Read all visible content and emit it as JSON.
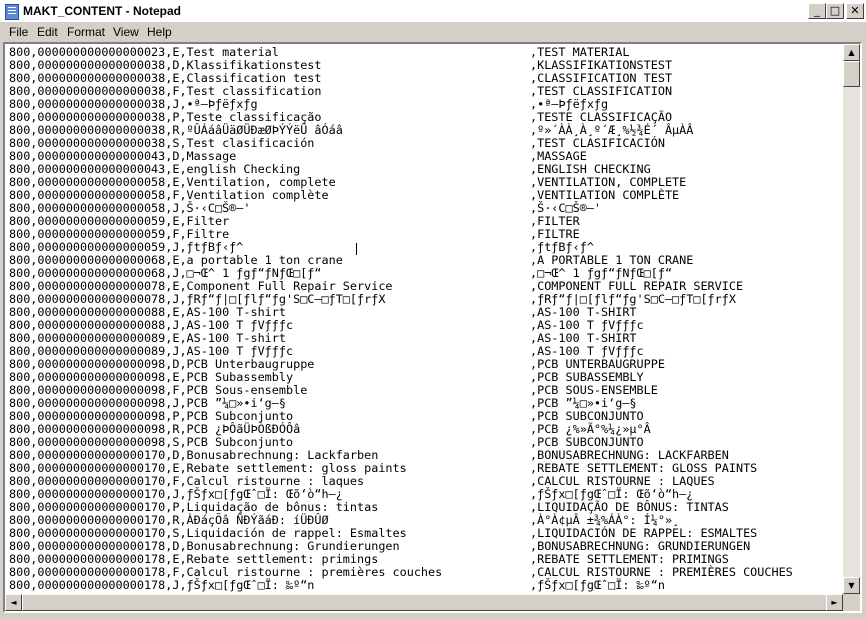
{
  "window": {
    "title": "MAKT_CONTENT - Notepad"
  },
  "menu": [
    "File",
    "Edit",
    "Format",
    "View",
    "Help"
  ],
  "lines": [
    [
      "800,000000000000000023,E,Test material",
      ",TEST MATERIAL"
    ],
    [
      "800,000000000000000038,D,Klassifikationstest",
      ",KLASSIFIKATIONSTEST"
    ],
    [
      "800,000000000000000038,E,Classification test",
      ",CLASSIFICATION TEST"
    ],
    [
      "800,000000000000000038,F,Test classification",
      ",TEST CLASSIFICATION"
    ],
    [
      "800,000000000000000038,J,•ª–Þƒëƒxƒg",
      ",•ª–Þƒëƒxƒg"
    ],
    [
      "800,000000000000000038,P,Teste classificação",
      ",TESTE CLASSIFICAÇÃO"
    ],
    [
      "800,000000000000000038,R,ºÛÁáâÜäØÜÐæØÞÝÝëÜ âÓáâ",
      ",º»´ÀÀ¸À¸º´Æ¸%½¾É´ ÂµÀÂ"
    ],
    [
      "800,000000000000000038,S,Test clasificación",
      ",TEST CLASIFICACIÓN"
    ],
    [
      "800,000000000000000043,D,Massage",
      ",MASSAGE"
    ],
    [
      "800,000000000000000043,E,english Checking",
      ",ENGLISH CHECKING"
    ],
    [
      "800,000000000000000058,E,Ventilation, complete",
      ",VENTILATION, COMPLETE"
    ],
    [
      "800,000000000000000058,F,Ventilation complète",
      ",VENTILATION COMPLÈTE"
    ],
    [
      "800,000000000000000058,J,Š·‹C□Š®—'",
      ",Š·‹C□Š®—'"
    ],
    [
      "800,000000000000000059,E,Filter",
      ",FILTER"
    ],
    [
      "800,000000000000000059,F,Filtre",
      ",FILTRE"
    ],
    [
      "800,000000000000000059,J,ƒtƒBƒ‹ƒ^",
      ",ƒtƒBƒ‹ƒ^"
    ],
    [
      "800,000000000000000068,E,a portable 1 ton crane",
      ",A PORTABLE 1 TON CRANE"
    ],
    [
      "800,000000000000000068,J,□¬Œ^ 1 ƒgƒ“ƒNƒŒ□[ƒ“",
      ",□¬Œ^ 1 ƒgƒ“ƒNƒŒ□[ƒ“"
    ],
    [
      "800,000000000000000078,E,Component Full Repair Service",
      ",COMPONENT FULL REPAIR SERVICE"
    ],
    [
      "800,000000000000000078,J,ƒRƒ“ƒ|□[ƒlƒ“ƒg'S□C—□ƒT□[ƒrƒX",
      ",ƒRƒ“ƒ|□[ƒlƒ“ƒg'S□C—□ƒT□[ƒrƒX"
    ],
    [
      "800,000000000000000088,E,AS-100 T-shirt",
      ",AS-100 T-SHIRT"
    ],
    [
      "800,000000000000000088,J,AS-100 T ƒVƒƒƒc",
      ",AS-100 T ƒVƒƒƒc"
    ],
    [
      "800,000000000000000089,E,AS-100 T-shirt",
      ",AS-100 T-SHIRT"
    ],
    [
      "800,000000000000000089,J,AS-100 T ƒVƒƒƒc",
      ",AS-100 T ƒVƒƒƒc"
    ],
    [
      "800,000000000000000098,D,PCB Unterbaugruppe",
      ",PCB UNTERBAUGRUPPE"
    ],
    [
      "800,000000000000000098,E,PCB Subassembly",
      ",PCB SUBASSEMBLY"
    ],
    [
      "800,000000000000000098,F,PCB Sous-ensemble",
      ",PCB SOUS-ENSEMBLE"
    ],
    [
      "800,000000000000000098,J,PCB ”¼□»•i‘g—§",
      ",PCB ”¼□»•i‘g—§"
    ],
    [
      "800,000000000000000098,P,PCB Subconjunto",
      ",PCB SUBCONJUNTO"
    ],
    [
      "800,000000000000000098,R,PCB ¿ÞÔãÜÞÒßÐÓÔâ",
      ",PCB ¿%»Ã°%¼¿»µ°Â"
    ],
    [
      "800,000000000000000098,S,PCB Subconjunto",
      ",PCB SUBCONJUNTO"
    ],
    [
      "800,000000000000000170,D,Bonusabrechnung: Lackfarben",
      ",BONUSABRECHNUNG: LACKFARBEN"
    ],
    [
      "800,000000000000000170,E,Rebate settlement: gloss paints",
      ",REBATE SETTLEMENT: GLOSS PAINTS"
    ],
    [
      "800,000000000000000170,F,Calcul ristourne : laques",
      ",CALCUL RISTOURNE : LAQUES"
    ],
    [
      "800,000000000000000170,J,ƒŠƒx□[ƒgŒˆ□Ï: Œõ‘ò“h—¿",
      ",ƒŠƒx□[ƒgŒˆ□Ï: Œõ‘ò“h—¿"
    ],
    [
      "800,000000000000000170,P,Liquidação de bônus: tintas",
      ",LIQUIDAÇÃO DE BÔNUS: TINTAS"
    ],
    [
      "800,000000000000000170,R,ÀÐáçÕâ ÑÐÝãáÐ: íÜÐÛØ",
      ",À°À¢µÂ ±¾%ÁÀ°: Í¼°»¸"
    ],
    [
      "800,000000000000000170,S,Liquidación de rappel: Esmaltes",
      ",LIQUIDACIÓN DE RAPPEL: ESMALTES"
    ],
    [
      "800,000000000000000178,D,Bonusabrechnung: Grundierungen",
      ",BONUSABRECHNUNG: GRUNDIERUNGEN"
    ],
    [
      "800,000000000000000178,E,Rebate settlement: primings",
      ",REBATE SETTLEMENT: PRIMINGS"
    ],
    [
      "800,000000000000000178,F,Calcul ristourne : premières couches",
      ",CALCUL RISTOURNE : PREMIÈRES COUCHES"
    ],
    [
      "800,000000000000000178,J,ƒŠƒx□[ƒgŒˆ□Ï: ‰º“n",
      ",ƒŠƒx□[ƒgŒˆ□Ï: ‰º“n"
    ]
  ]
}
